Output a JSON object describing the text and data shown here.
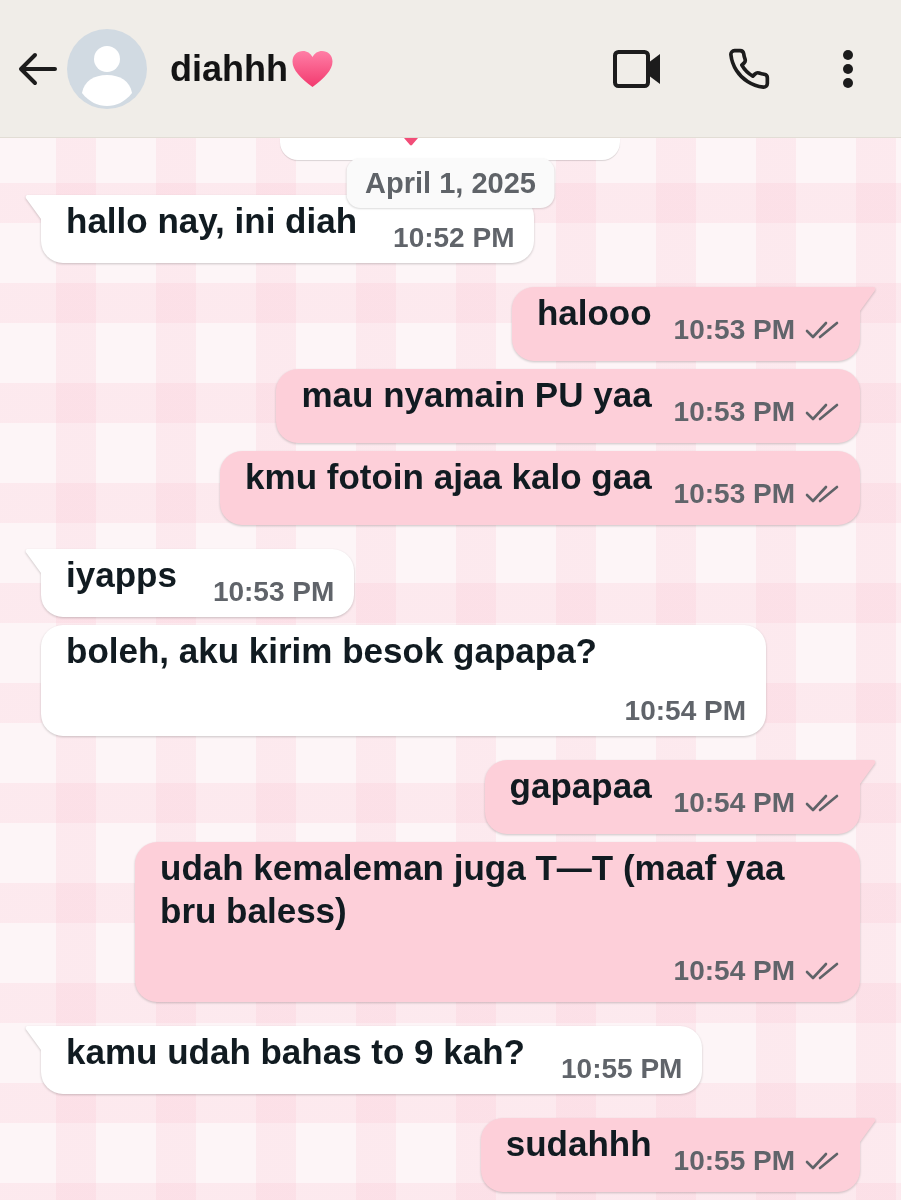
{
  "header": {
    "contact_name": "diahhh"
  },
  "date_chip": "April 1, 2025",
  "messages": [
    {
      "kind": "incoming",
      "tail": true,
      "text": "hallo nay, ini diah",
      "time": "10:52 PM"
    },
    {
      "kind": "outgoing",
      "tail": true,
      "text": "halooo",
      "time": "10:53 PM",
      "read": false
    },
    {
      "kind": "outgoing",
      "tail": false,
      "text": "mau nyamain PU yaa",
      "time": "10:53 PM",
      "read": false
    },
    {
      "kind": "outgoing",
      "tail": false,
      "text": "kmu fotoin ajaa kalo gaa",
      "time": "10:53 PM",
      "read": false
    },
    {
      "kind": "incoming",
      "tail": true,
      "text": "iyapps",
      "time": "10:53 PM"
    },
    {
      "kind": "incoming",
      "tail": false,
      "text": "boleh, aku kirim besok gapapa?",
      "time": "10:54 PM"
    },
    {
      "kind": "outgoing",
      "tail": true,
      "text": "gapapaa",
      "time": "10:54 PM",
      "read": false
    },
    {
      "kind": "outgoing",
      "tail": false,
      "text": "udah kemaleman juga T—T (maaf yaa bru baless)",
      "time": "10:54 PM",
      "read": false
    },
    {
      "kind": "incoming",
      "tail": true,
      "text": "kamu udah bahas to 9 kah?",
      "time": "10:55 PM"
    },
    {
      "kind": "outgoing",
      "tail": true,
      "text": "sudahhh",
      "time": "10:55 PM",
      "read": false
    }
  ]
}
